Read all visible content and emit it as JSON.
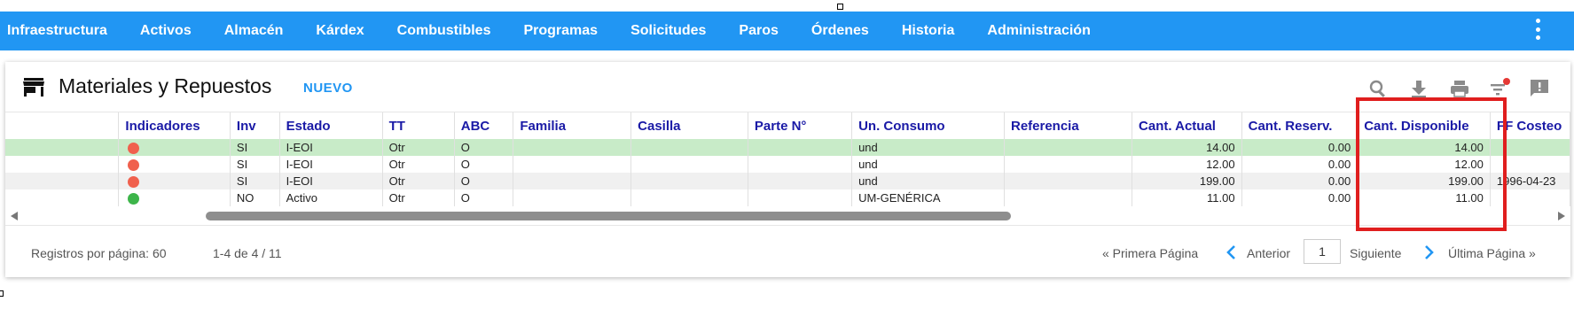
{
  "nav": {
    "items": [
      {
        "label": "Infraestructura"
      },
      {
        "label": "Activos"
      },
      {
        "label": "Almacén"
      },
      {
        "label": "Kárdex"
      },
      {
        "label": "Combustibles"
      },
      {
        "label": "Programas"
      },
      {
        "label": "Solicitudes"
      },
      {
        "label": "Paros"
      },
      {
        "label": "Órdenes"
      },
      {
        "label": "Historia"
      },
      {
        "label": "Administración"
      }
    ],
    "menu_icon": "more-vert-icon"
  },
  "header": {
    "icon": "store-icon",
    "title": "Materiales y Repuestos",
    "new_label": "NUEVO",
    "tools": [
      "search-icon",
      "download-icon",
      "print-icon",
      "filter-icon",
      "feedback-icon"
    ],
    "filter_badge_color": "#e53935"
  },
  "table": {
    "columns": [
      "",
      "Indicadores",
      "Inv",
      "Estado",
      "TT",
      "ABC",
      "Familia",
      "Casilla",
      "Parte N°",
      "Un. Consumo",
      "Referencia",
      "Cant. Actual",
      "Cant. Reserv.",
      "Cant. Disponible",
      "FF Costeo"
    ],
    "rows": [
      {
        "indicator_color": "#f0604d",
        "inv": "SI",
        "estado": "I-EOI",
        "tt": "Otr",
        "abc": "O",
        "familia": "",
        "casilla": "",
        "parte": "",
        "un_consumo": "und",
        "referencia": "",
        "cant_actual": "14.00",
        "cant_reserv": "0.00",
        "cant_disponible": "14.00",
        "ff_costeo": ""
      },
      {
        "indicator_color": "#f0604d",
        "inv": "SI",
        "estado": "I-EOI",
        "tt": "Otr",
        "abc": "O",
        "familia": "",
        "casilla": "",
        "parte": "",
        "un_consumo": "und",
        "referencia": "",
        "cant_actual": "12.00",
        "cant_reserv": "0.00",
        "cant_disponible": "12.00",
        "ff_costeo": ""
      },
      {
        "indicator_color": "#f0604d",
        "inv": "SI",
        "estado": "I-EOI",
        "tt": "Otr",
        "abc": "O",
        "familia": "",
        "casilla": "",
        "parte": "",
        "un_consumo": "und",
        "referencia": "",
        "cant_actual": "199.00",
        "cant_reserv": "0.00",
        "cant_disponible": "199.00",
        "ff_costeo": "1996-04-23"
      },
      {
        "indicator_color": "#3db54a",
        "inv": "NO",
        "estado": "Activo",
        "tt": "Otr",
        "abc": "O",
        "familia": "",
        "casilla": "",
        "parte": "",
        "un_consumo": "UM-GENÉRICA",
        "referencia": "",
        "cant_actual": "11.00",
        "cant_reserv": "0.00",
        "cant_disponible": "11.00",
        "ff_costeo": ""
      }
    ]
  },
  "footer": {
    "per_page": "Registros por página: 60",
    "range": "1-4 de 4 / 11",
    "first": "« Primera Página",
    "prev": "Anterior",
    "page_value": "1",
    "next": "Siguiente",
    "last": "Última Página »"
  },
  "colors": {
    "accent": "#2196f3",
    "header_text": "#1a1aa6",
    "selected_row": "#c8ebc8",
    "highlight": "#e01e1e"
  }
}
